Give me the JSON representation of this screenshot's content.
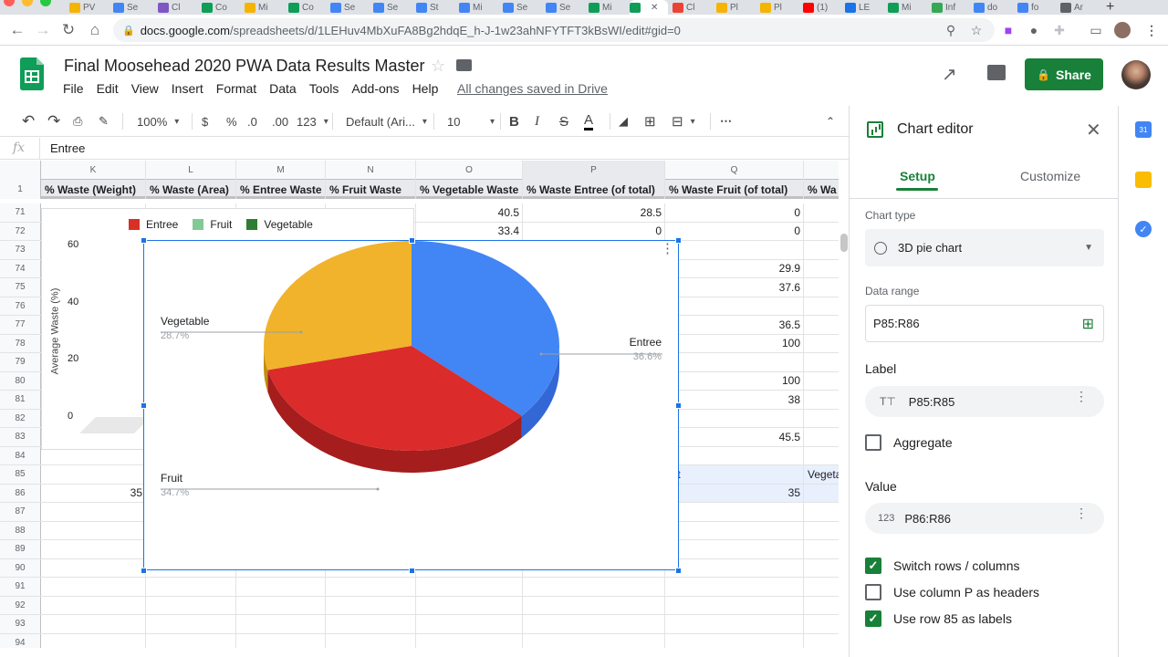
{
  "browser": {
    "tabs": [
      "PV",
      "Se",
      "Cl",
      "Co",
      "Mi",
      "Co",
      "Se",
      "Se",
      "St",
      "Mi",
      "Se",
      "Se",
      "Mi",
      "",
      "Cl",
      "Pl",
      "Pl",
      "(1)",
      "LE",
      "Mi",
      "Inf",
      "do",
      "fo",
      "Ar"
    ],
    "url_host": "docs.google.com",
    "url_path": "/spreadsheets/d/1LEHuv4MbXuFA8Bg2hdqE_h-J-1w23ahNFYTFT3kBsWI/edit#gid=0"
  },
  "doc": {
    "title": "Final Moosehead 2020 PWA Data Results Master",
    "menu": [
      "File",
      "Edit",
      "View",
      "Insert",
      "Format",
      "Data",
      "Tools",
      "Add-ons",
      "Help"
    ],
    "saved": "All changes saved in Drive",
    "share_label": "Share"
  },
  "toolbar": {
    "zoom": "100%",
    "currency": "$",
    "percent": "%",
    "dec_less": ".0",
    "dec_more": ".00",
    "more_formats": "123",
    "font": "Default (Ari...",
    "font_size": "10",
    "bold": "B",
    "italic": "I",
    "strike": "S",
    "text_color": "A"
  },
  "formula_bar": {
    "fx": "fx",
    "value": "Entree"
  },
  "grid": {
    "columns": [
      "K",
      "L",
      "M",
      "N",
      "O",
      "P",
      "Q"
    ],
    "header_row": {
      "num": "1",
      "cells": [
        "% Waste (Weight)",
        "% Waste (Area)",
        "% Entree Waste",
        "% Fruit Waste",
        "% Vegetable Waste",
        "% Waste Entree (of total)",
        "% Waste Fruit (of total)",
        "% Wa"
      ]
    },
    "rows": [
      {
        "num": "71",
        "O": "40.5",
        "P": "28.5",
        "Q": "0"
      },
      {
        "num": "72",
        "O": "33.4",
        "P": "0",
        "Q": "0"
      },
      {
        "num": "73"
      },
      {
        "num": "74",
        "Q": "29.9"
      },
      {
        "num": "75",
        "Q": "37.6"
      },
      {
        "num": "76"
      },
      {
        "num": "77",
        "Q": "36.5"
      },
      {
        "num": "78",
        "Q": "100"
      },
      {
        "num": "79"
      },
      {
        "num": "80",
        "Q": "100"
      },
      {
        "num": "81",
        "Q": "38"
      },
      {
        "num": "82"
      },
      {
        "num": "83",
        "Q": "45.5"
      },
      {
        "num": "84"
      },
      {
        "num": "85",
        "Q": "uit",
        "R": "Vegeta"
      },
      {
        "num": "86",
        "K": "35",
        "Q": "35"
      },
      {
        "num": "87"
      },
      {
        "num": "88"
      },
      {
        "num": "89"
      },
      {
        "num": "90"
      },
      {
        "num": "91"
      },
      {
        "num": "92"
      },
      {
        "num": "93"
      },
      {
        "num": "94"
      }
    ]
  },
  "bg_chart": {
    "legend": [
      {
        "label": "Entree",
        "color": "#d93025"
      },
      {
        "label": "Fruit",
        "color": "#81c995"
      },
      {
        "label": "Vegetable",
        "color": "#2e7d32"
      }
    ],
    "y_ticks": [
      "60",
      "40",
      "20",
      "0"
    ],
    "ylabel": "Average Waste (%)"
  },
  "chart_data": {
    "type": "pie",
    "variant": "3d",
    "slices": [
      {
        "label": "Entree",
        "value": 36.6,
        "pct": "36.6%",
        "color": "#4285f4",
        "side": "#3367d6"
      },
      {
        "label": "Fruit",
        "value": 34.7,
        "pct": "34.7%",
        "color": "#db2b2b",
        "side": "#a51d1d"
      },
      {
        "label": "Vegetable",
        "value": 28.7,
        "pct": "28.7%",
        "color": "#f0b32b",
        "side": "#c28e14"
      }
    ]
  },
  "editor": {
    "title": "Chart editor",
    "tabs": {
      "setup": "Setup",
      "customize": "Customize"
    },
    "chart_type_label": "Chart type",
    "chart_type": "3D pie chart",
    "data_range_label": "Data range",
    "data_range": "P85:R86",
    "label_heading": "Label",
    "label_range": "P85:R85",
    "aggregate": "Aggregate",
    "value_heading": "Value",
    "value_range": "P86:R86",
    "options": [
      {
        "label": "Switch rows / columns",
        "checked": true
      },
      {
        "label": "Use column P as headers",
        "checked": false
      },
      {
        "label": "Use row 85 as labels",
        "checked": true
      }
    ]
  }
}
